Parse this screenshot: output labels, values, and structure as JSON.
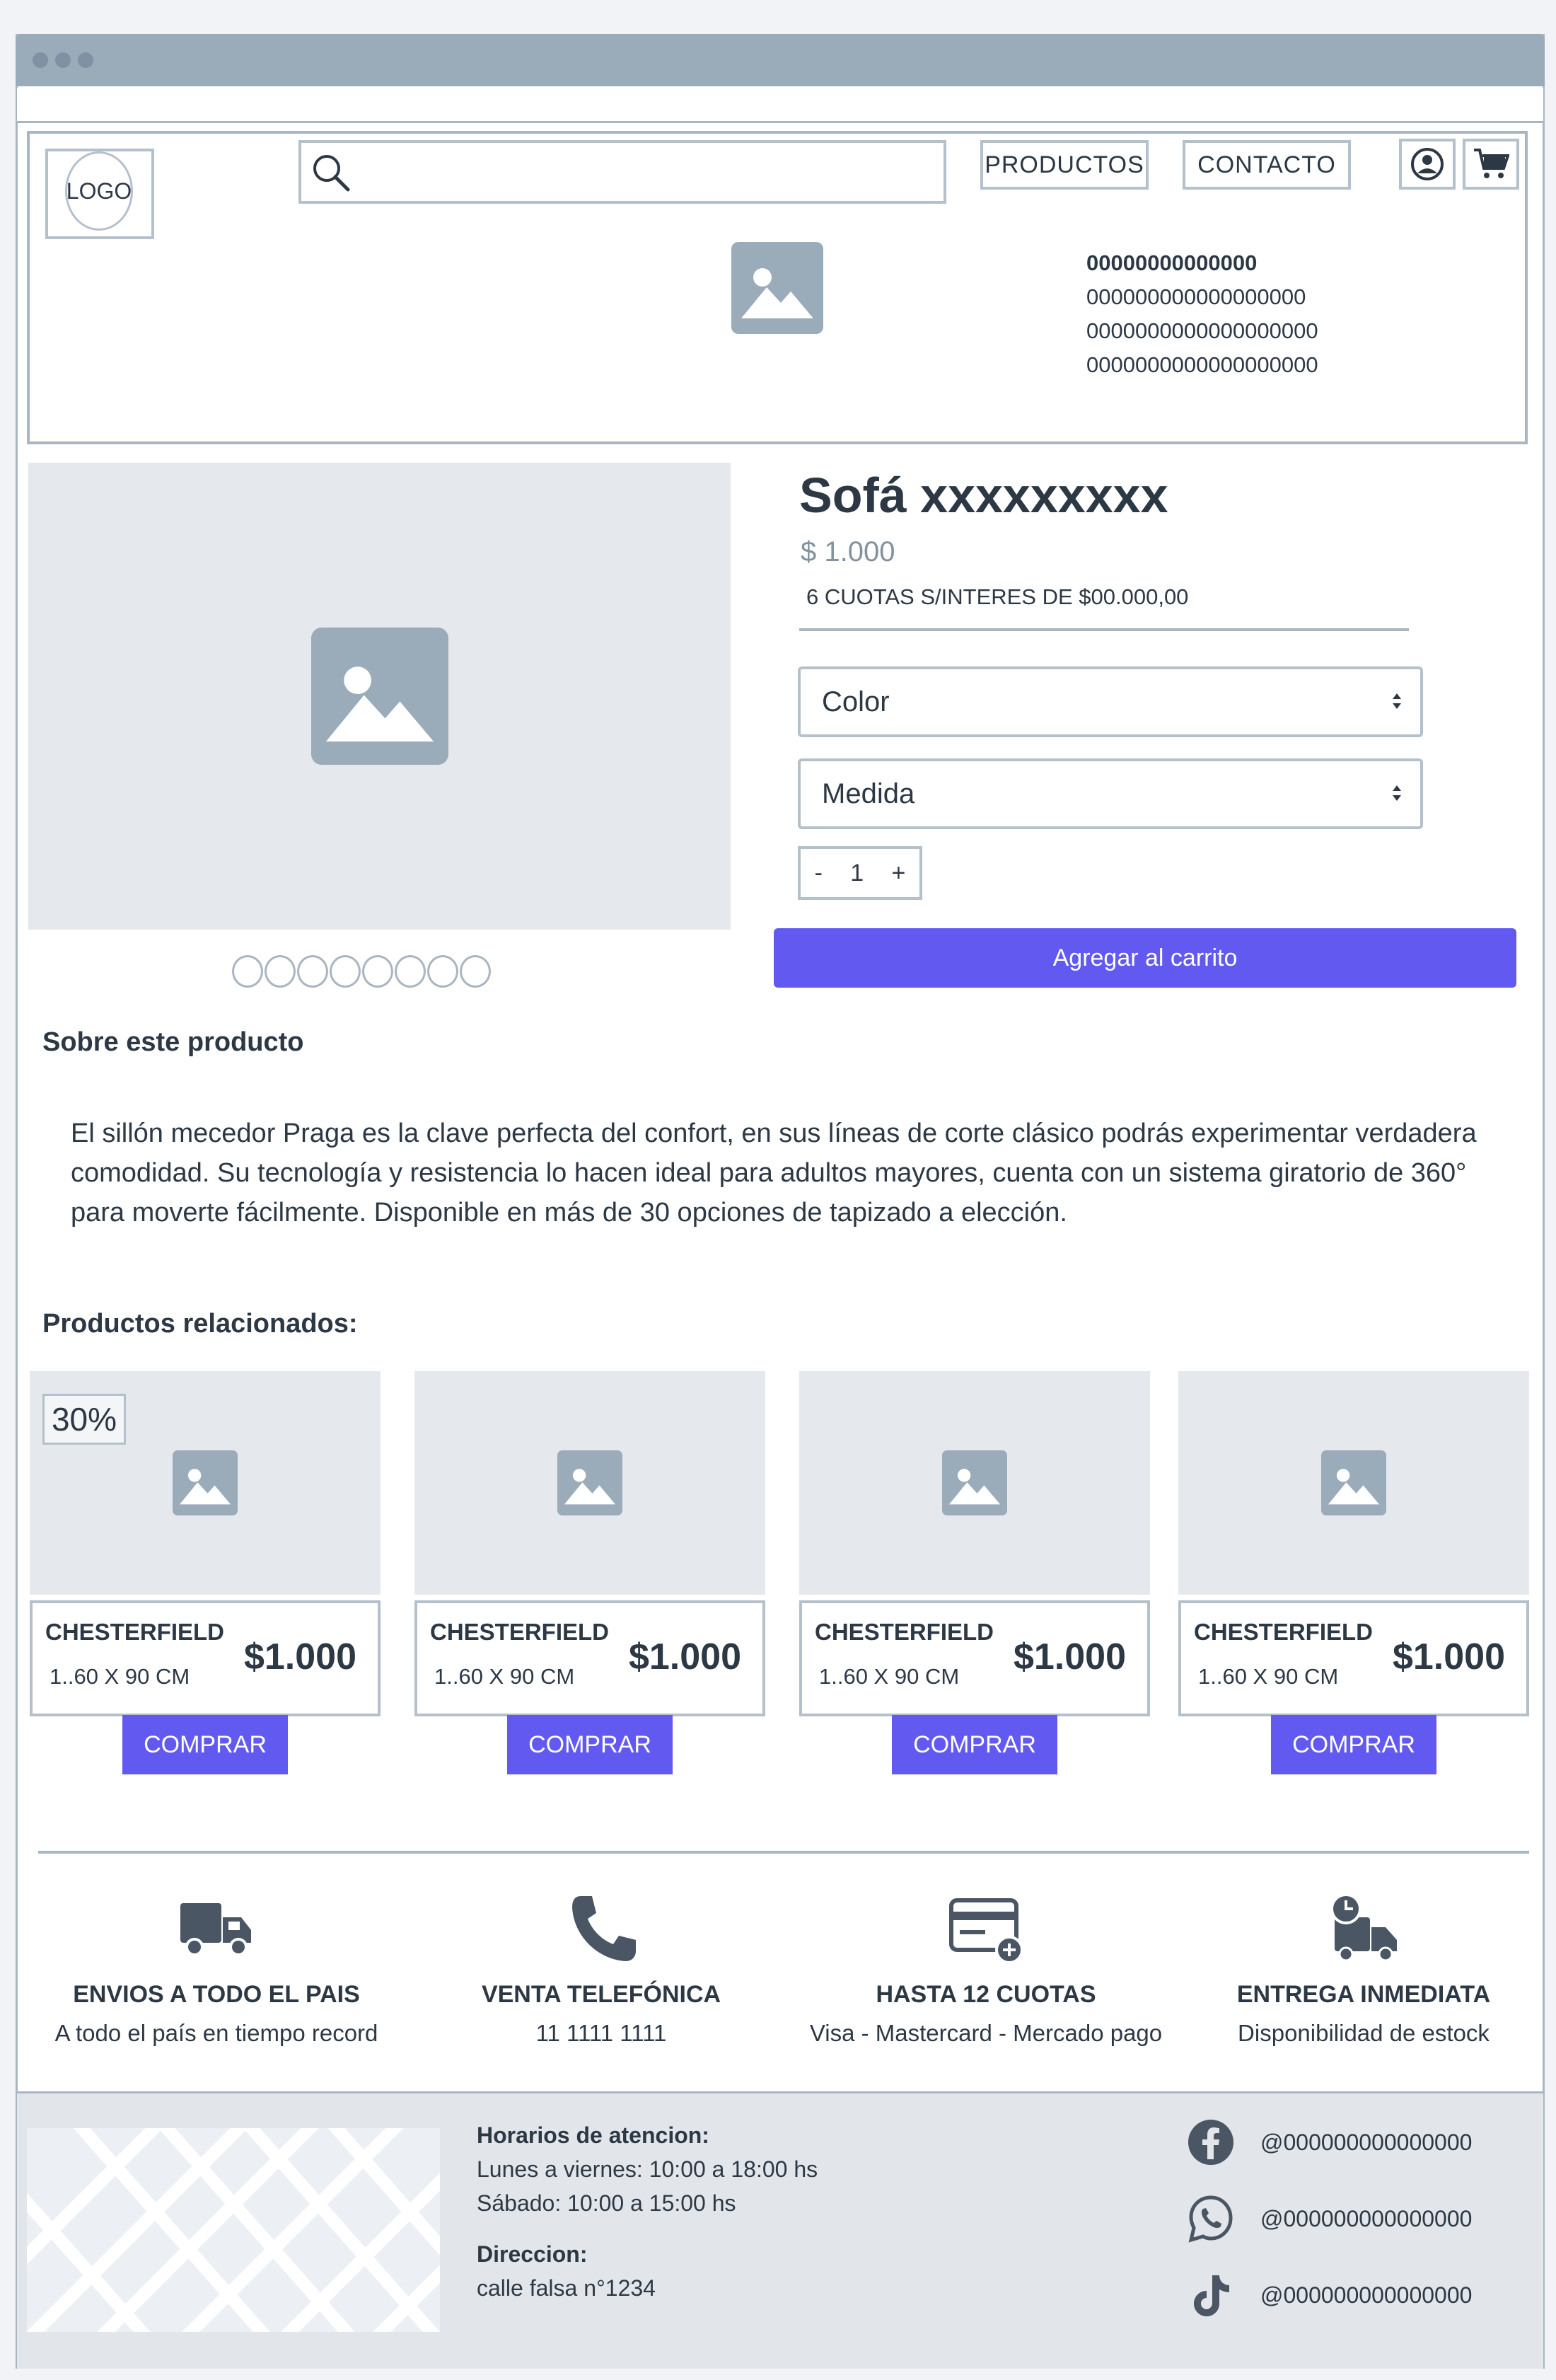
{
  "header": {
    "logo_text": "LOGO",
    "search_placeholder": "",
    "nav": {
      "productos": "PRODUCTOS",
      "contacto": "CONTACTO"
    },
    "info_lines": [
      "00000000000000",
      "000000000000000000",
      "0000000000000000000",
      "0000000000000000000"
    ]
  },
  "product": {
    "title": "Sofá xxxxxxxxx",
    "price": "$ 1.000",
    "installments": "6 CUOTAS S/INTERES DE $00.000,00",
    "color_label": "Color",
    "medida_label": "Medida",
    "qty_minus": "-",
    "qty_value": "1",
    "qty_plus": "+",
    "add_to_cart": "Agregar al carrito",
    "carousel_count": 8
  },
  "about": {
    "title": "Sobre este producto",
    "text": "El sillón mecedor Praga es la clave perfecta del confort, en sus líneas de corte clásico podrás experimentar verdadera comodidad. Su tecnología y resistencia lo hacen ideal para adultos mayores, cuenta con un sistema giratorio de 360° para moverte fácilmente. Disponible en más de 30 opciones de tapizado a elección."
  },
  "related": {
    "title": "Productos relacionados:",
    "badge": "30%",
    "items": [
      {
        "name": "CHESTERFIELD",
        "size": "1..60 X 90 CM",
        "price": "$1.000",
        "buy": "COMPRAR"
      },
      {
        "name": "CHESTERFIELD",
        "size": "1..60 X 90 CM",
        "price": "$1.000",
        "buy": "COMPRAR"
      },
      {
        "name": "CHESTERFIELD",
        "size": "1..60 X 90 CM",
        "price": "$1.000",
        "buy": "COMPRAR"
      },
      {
        "name": "CHESTERFIELD",
        "size": "1..60 X 90 CM",
        "price": "$1.000",
        "buy": "COMPRAR"
      }
    ]
  },
  "features": [
    {
      "icon": "truck-icon",
      "title": "ENVIOS A TODO EL PAIS",
      "sub": "A todo el país en tiempo record"
    },
    {
      "icon": "phone-icon",
      "title": "VENTA TELEFÓNICA",
      "sub": "11 1111 1111"
    },
    {
      "icon": "credit-card-icon",
      "title": "HASTA 12 CUOTAS",
      "sub": "Visa - Mastercard - Mercado pago"
    },
    {
      "icon": "delivery-clock-icon",
      "title": "ENTREGA INMEDIATA",
      "sub": "Disponibilidad de estock"
    }
  ],
  "footer": {
    "hours_title": "Horarios de atencion:",
    "hours_weekdays": "Lunes a viernes: 10:00 a 18:00 hs",
    "hours_saturday": "Sábado: 10:00 a 15:00 hs",
    "address_title": "Direccion:",
    "address": "calle falsa n°1234",
    "social": [
      {
        "icon": "facebook-icon",
        "handle": "@000000000000000"
      },
      {
        "icon": "whatsapp-icon",
        "handle": "@000000000000000"
      },
      {
        "icon": "tiktok-icon",
        "handle": "@000000000000000"
      }
    ]
  },
  "colors": {
    "accent": "#6259f0",
    "placeholder": "#9aabba",
    "text": "#2d3845",
    "border": "#b4c0cb"
  }
}
